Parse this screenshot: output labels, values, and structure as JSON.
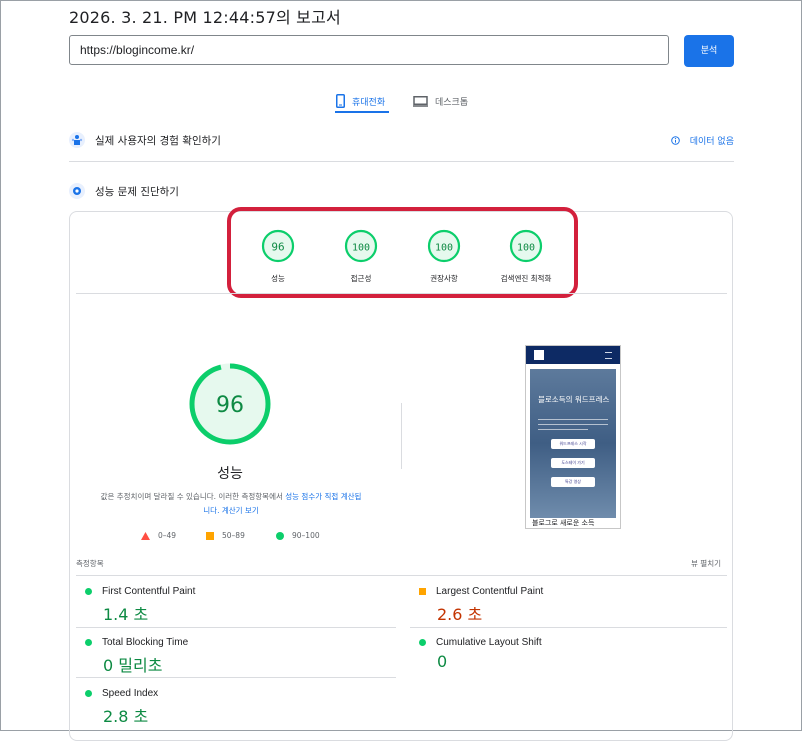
{
  "page_title": "2026. 3. 21. PM 12:44:57의 보고서",
  "url_input": {
    "value": "https://blogincome.kr/"
  },
  "analyze_button": "분석",
  "tabs": [
    {
      "label": "휴대전화",
      "icon": "smartphone-icon",
      "active": true
    },
    {
      "label": "데스크톱",
      "icon": "desktop-icon",
      "active": false
    }
  ],
  "field_data": {
    "title": "실제 사용자의 경험 확인하기",
    "no_data": "데이터 없음"
  },
  "diagnose": {
    "title": "성능 문제 진단하기"
  },
  "scores": [
    {
      "value": "96",
      "label": "성능"
    },
    {
      "value": "100",
      "label": "접근성"
    },
    {
      "value": "100",
      "label": "권장사항"
    },
    {
      "value": "100",
      "label": "검색엔진 최적화"
    }
  ],
  "performance": {
    "score": "96",
    "score_fraction": 0.96,
    "label": "성능",
    "desc_text": "값은 추정치이며 달라질 수 있습니다. 이러한 측정항목에서 ",
    "desc_link": "성능 점수가 직접 계산됩",
    "desc_link2": "니다. 계산기 보기"
  },
  "legend": [
    {
      "icon": "triangle-red-icon",
      "label": "0–49"
    },
    {
      "icon": "square-orange-icon",
      "label": "50–89"
    },
    {
      "icon": "circle-green-icon",
      "label": "90–100"
    }
  ],
  "preview": {
    "hero_title": "블로소득의 워드프레스",
    "btn1": "워드프레스 시작",
    "btn2": "도스테이 가기",
    "btn3": "특강 영상",
    "bottom_text": "블로그로 새로운 소득"
  },
  "metrics_header": "측정항목",
  "collapse_label": "뷰 펼치기",
  "metrics": [
    {
      "name": "First Contentful Paint",
      "value": "1.4 초",
      "status": "good",
      "color": "#0d8a43"
    },
    {
      "name": "Largest Contentful Paint",
      "value": "2.6 초",
      "status": "average",
      "color": "#c33300"
    },
    {
      "name": "Total Blocking Time",
      "value": "0 밀리초",
      "status": "good",
      "color": "#0d8a43"
    },
    {
      "name": "Cumulative Layout Shift",
      "value": "0",
      "status": "good",
      "color": "#0d8a43"
    },
    {
      "name": "Speed Index",
      "value": "2.8 초",
      "status": "good",
      "color": "#0d8a43"
    }
  ],
  "colors": {
    "accent": "#1a73e8",
    "good": "#0cce6b",
    "average": "#ffa400",
    "poor": "#ff4e42",
    "highlight": "#d3203c"
  }
}
